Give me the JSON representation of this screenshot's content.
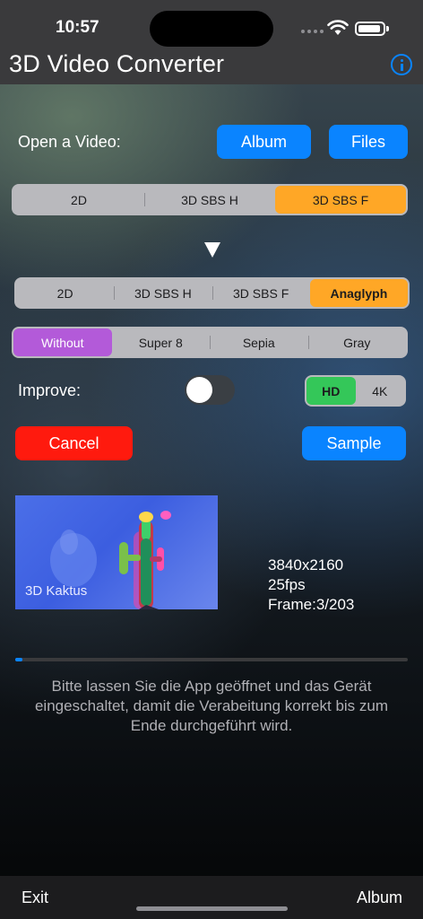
{
  "status": {
    "time": "10:57"
  },
  "nav": {
    "title": "3D Video Converter",
    "info_icon": "info-circle-icon"
  },
  "open": {
    "label": "Open a Video:",
    "album": "Album",
    "files": "Files"
  },
  "input_format": {
    "options": [
      "2D",
      "3D SBS H",
      "3D SBS F"
    ],
    "selected": 2
  },
  "output_format": {
    "options": [
      "2D",
      "3D SBS H",
      "3D SBS F",
      "Anaglyph"
    ],
    "selected": 3
  },
  "filter": {
    "options": [
      "Without",
      "Super 8",
      "Sepia",
      "Gray"
    ],
    "selected": 0
  },
  "improve": {
    "label": "Improve:",
    "on": false
  },
  "resolution": {
    "options": [
      "HD",
      "4K"
    ],
    "selected": 0
  },
  "actions": {
    "cancel": "Cancel",
    "sample": "Sample"
  },
  "preview": {
    "caption": "3D Kaktus"
  },
  "video_info": {
    "resolution": "3840x2160",
    "fps": "25fps",
    "frame": "Frame:3/203"
  },
  "progress": {
    "fraction": 0.015
  },
  "message": "Bitte lassen Sie die App geöffnet und das Gerät eingeschaltet, damit die Verabeitung korrekt bis zum Ende durchgeführt wird.",
  "toolbar": {
    "exit": "Exit",
    "album": "Album"
  },
  "colors": {
    "accent": "#0a84ff",
    "selected_format": "#ffa726",
    "selected_filter": "#b35ad9",
    "selected_resolution": "#34c759",
    "cancel": "#ff1a0e"
  }
}
